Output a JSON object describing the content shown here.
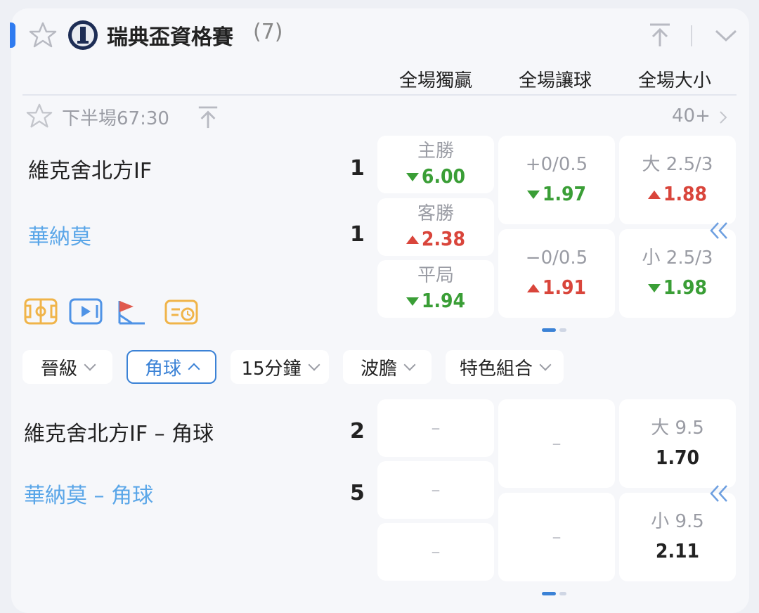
{
  "league": {
    "title": "瑞典盃資格賽",
    "count": "(7)"
  },
  "columns": [
    "全場獨贏",
    "全場讓球",
    "全場大小"
  ],
  "match": {
    "period": "下半場67:30",
    "more": "40+",
    "home": {
      "name": "維克舍北方IF",
      "score": "1"
    },
    "away": {
      "name": "華納莫",
      "score": "1"
    },
    "moneyline": [
      {
        "label": "主勝",
        "odd": "6.00",
        "trend": "down"
      },
      {
        "label": "客勝",
        "odd": "2.38",
        "trend": "up"
      },
      {
        "label": "平局",
        "odd": "1.94",
        "trend": "down"
      }
    ],
    "handicap": [
      {
        "label": "+0/0.5",
        "odd": "1.97",
        "trend": "down"
      },
      {
        "label": "−0/0.5",
        "odd": "1.91",
        "trend": "up"
      }
    ],
    "totals": [
      {
        "label": "大 2.5/3",
        "odd": "1.88",
        "trend": "up"
      },
      {
        "label": "小 2.5/3",
        "odd": "1.98",
        "trend": "down"
      }
    ]
  },
  "filters": [
    {
      "label": "晉級",
      "active": false
    },
    {
      "label": "角球",
      "active": true
    },
    {
      "label": "15分鐘",
      "active": false
    },
    {
      "label": "波膽",
      "active": false
    },
    {
      "label": "特色組合",
      "active": false
    }
  ],
  "corners": {
    "home": {
      "name": "維克舍北方IF – 角球",
      "score": "2"
    },
    "away": {
      "name": "華納莫 – 角球",
      "score": "5"
    },
    "moneyline": [
      "–",
      "–",
      "–"
    ],
    "handicap": [
      "–",
      "–"
    ],
    "totals": [
      {
        "label": "大 9.5",
        "odd": "1.70"
      },
      {
        "label": "小 9.5",
        "odd": "2.11"
      }
    ]
  },
  "icons": [
    "star-icon",
    "league-logo",
    "pin-top-icon",
    "collapse-chevron-icon",
    "pitch-icon",
    "video-icon",
    "corner-flag-icon",
    "timeline-icon",
    "slide-left-icon"
  ],
  "colors": {
    "accent": "#2f7bf0",
    "up": "#d9453b",
    "down": "#3a9e36",
    "away_team": "#5aa6e8"
  }
}
